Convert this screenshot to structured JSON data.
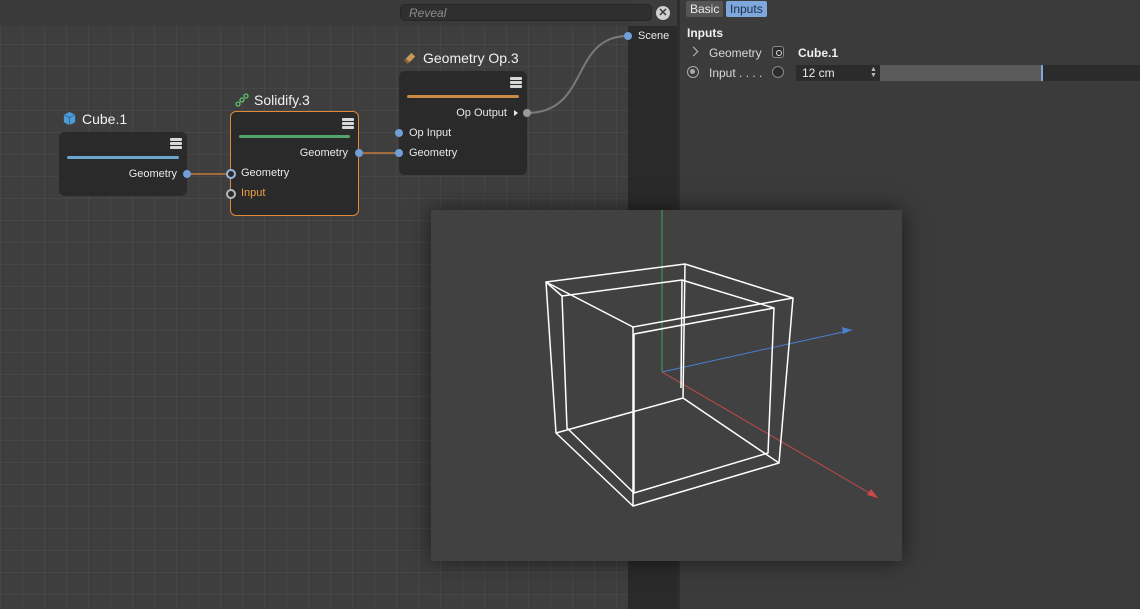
{
  "search": {
    "placeholder": "Reveal"
  },
  "nodes": {
    "cube": {
      "title": "Cube.1",
      "output": "Geometry",
      "accent": "#6aa6cf"
    },
    "solidify": {
      "title": "Solidify.3",
      "output": "Geometry",
      "input_geometry": "Geometry",
      "input_input": "Input",
      "accent": "#52a86a"
    },
    "geometry_op": {
      "title": "Geometry Op.3",
      "output": "Op Output",
      "input_op": "Op Input",
      "input_geometry": "Geometry",
      "accent": "#c98a45"
    }
  },
  "scene": {
    "label": "Scene"
  },
  "attributes": {
    "tabs": [
      "Basic",
      "Inputs"
    ],
    "active_tab": "Inputs",
    "section": "Inputs",
    "rows": [
      {
        "label": "Geometry",
        "value": "Cube.1"
      },
      {
        "label": "Input . . . .",
        "value": "12 cm",
        "slider_fraction": 0.62
      }
    ]
  },
  "colors": {
    "selection": "#e08a3c",
    "port": "#6f9fd6",
    "wire": "#c47a3e"
  },
  "viewport": {
    "axes": [
      "x-red",
      "y-green",
      "z-blue"
    ]
  }
}
